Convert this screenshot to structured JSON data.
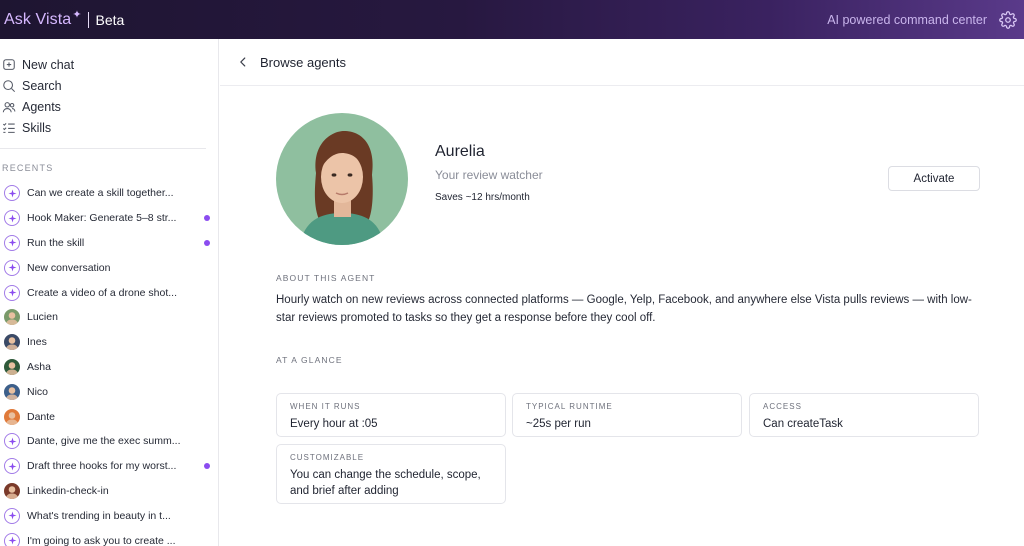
{
  "topbar": {
    "brand": "Ask Vista",
    "brand_tag": "Beta",
    "tagline": "AI powered command center",
    "settings_icon": "gear-icon"
  },
  "sidebar": {
    "nav": [
      {
        "label": "New chat",
        "icon": "new-chat-icon"
      },
      {
        "label": "Search",
        "icon": "search-icon"
      },
      {
        "label": "Agents",
        "icon": "agents-icon"
      },
      {
        "label": "Skills",
        "icon": "skills-icon"
      }
    ],
    "recents_label": "RECENTS",
    "recents": [
      {
        "label": "Can we create a skill together...",
        "kind": "chat",
        "unread": false
      },
      {
        "label": "Hook Maker: Generate 5–8 str...",
        "kind": "chat",
        "unread": true
      },
      {
        "label": "Run the skill",
        "kind": "chat",
        "unread": true
      },
      {
        "label": "New conversation",
        "kind": "chat",
        "unread": false
      },
      {
        "label": "Create a video of a drone shot...",
        "kind": "chat",
        "unread": false
      },
      {
        "label": "Lucien",
        "kind": "person",
        "color": "#7a9a6a",
        "unread": false
      },
      {
        "label": "Ines",
        "kind": "person",
        "color": "#3b4a66",
        "unread": false
      },
      {
        "label": "Asha",
        "kind": "person",
        "color": "#2f5a3a",
        "unread": false
      },
      {
        "label": "Nico",
        "kind": "person",
        "color": "#3d5f8a",
        "unread": false
      },
      {
        "label": "Dante",
        "kind": "person",
        "color": "#e07a3a",
        "unread": false
      },
      {
        "label": "Dante, give me the exec summ...",
        "kind": "chat",
        "unread": false
      },
      {
        "label": "Draft three hooks for my worst...",
        "kind": "chat",
        "unread": true
      },
      {
        "label": "Linkedin-check-in",
        "kind": "person",
        "color": "#7a3a2a",
        "unread": false
      },
      {
        "label": "What's trending in beauty in t...",
        "kind": "chat",
        "unread": false
      },
      {
        "label": "I'm going to ask you to create ...",
        "kind": "chat",
        "unread": false
      }
    ]
  },
  "main": {
    "title": "Browse agents",
    "agent": {
      "name": "Aurelia",
      "role": "Your review watcher",
      "saves": "Saves ~12 hrs/month",
      "activate_label": "Activate"
    },
    "about_label": "ABOUT THIS AGENT",
    "about_text": "Hourly watch on new reviews across connected platforms — Google, Yelp, Facebook, and anywhere else Vista pulls reviews — with low-star reviews promoted to tasks so they get a response before they cool off.",
    "glance_label": "AT A GLANCE",
    "cards": [
      {
        "label": "WHEN IT RUNS",
        "value": "Every hour at :05"
      },
      {
        "label": "TYPICAL RUNTIME",
        "value": "~25s per run"
      },
      {
        "label": "ACCESS",
        "value": "Can createTask"
      },
      {
        "label": "CUSTOMIZABLE",
        "value": "You can change the schedule, scope, and brief after adding"
      }
    ]
  },
  "colors": {
    "accent": "#8b4cf0",
    "brand_text": "#d6b8ff",
    "portrait_bg": "#8fbf9f"
  }
}
